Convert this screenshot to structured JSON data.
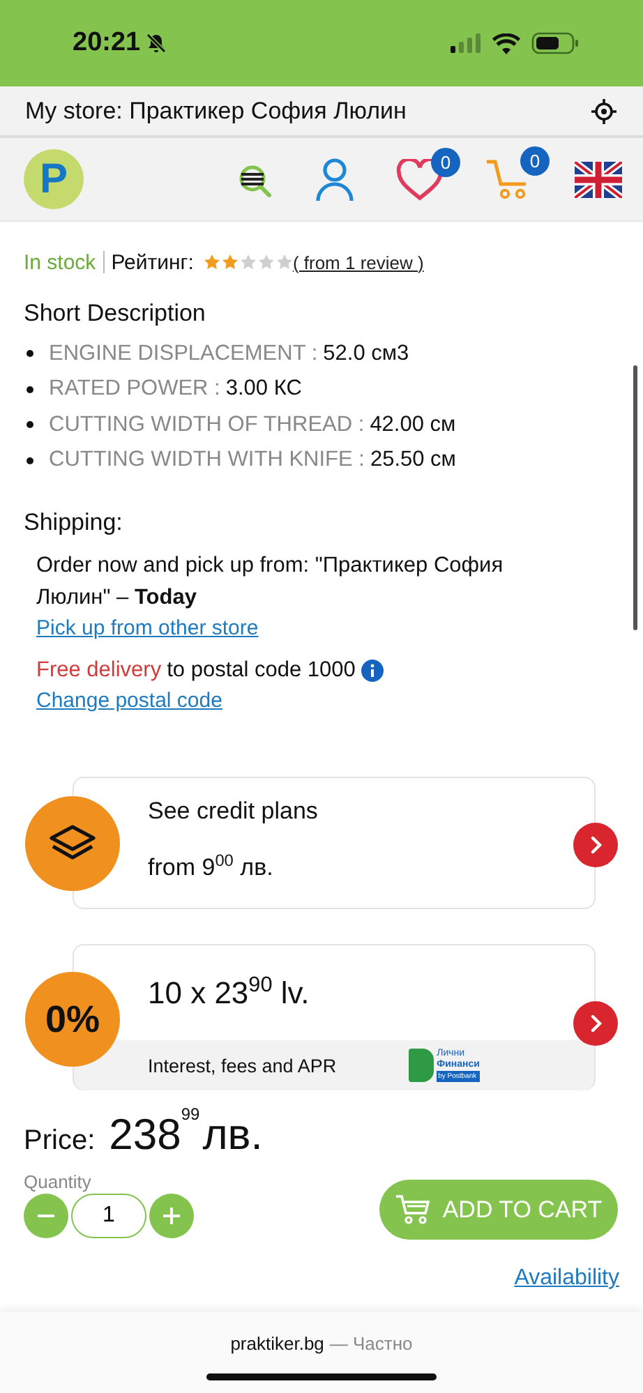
{
  "status_bar": {
    "time": "20:21"
  },
  "store_bar": {
    "label": "My store: Практикер София Люлин"
  },
  "header": {
    "wishlist_count": "0",
    "cart_count": "0",
    "logo": "P"
  },
  "stock": {
    "availability": "In stock",
    "rating_label": "Рейтинг:",
    "stars": 2,
    "reviews_link": "( from 1 review )"
  },
  "short_description": {
    "title": "Short Description",
    "items": [
      {
        "name": "ENGINE DISPLACEMENT :",
        "value": "52.0 см3"
      },
      {
        "name": "RATED POWER :",
        "value": "3.00 КС"
      },
      {
        "name": "CUTTING WIDTH OF THREAD :",
        "value": "42.00 см"
      },
      {
        "name": "CUTTING WIDTH WITH KNIFE :",
        "value": "25.50 см"
      }
    ]
  },
  "shipping": {
    "title": "Shipping:",
    "pickup_text": "Order now and pick up from: \"Практикер София Люлин\" – **Today**",
    "pickup_link": "Pick up from other store",
    "free_delivery": "Free delivery",
    "delivery_text": "to postal code 1000",
    "change_link": "Change postal code"
  },
  "credit_cards": [
    {
      "kind": "plans",
      "title": "See credit plans",
      "amount": "from 9$^{00}$ лв."
    },
    {
      "kind": "installments",
      "badge": "0%",
      "amount": "10 x 23$^{90}$ lv.",
      "footer": "Interest, fees and APR",
      "logo_lines": [
        "Лични",
        "Финанси",
        "by Postbank"
      ]
    }
  ],
  "price": {
    "label": "Price:",
    "amount": "238$^{99}$лв."
  },
  "quantity": {
    "label": "Quantity",
    "value": "1"
  },
  "add_to_cart": "ADD TO CART",
  "availability_link": "Availability",
  "browser_bar": {
    "domain": "praktiker.bg",
    "suffix": "— Частно"
  }
}
